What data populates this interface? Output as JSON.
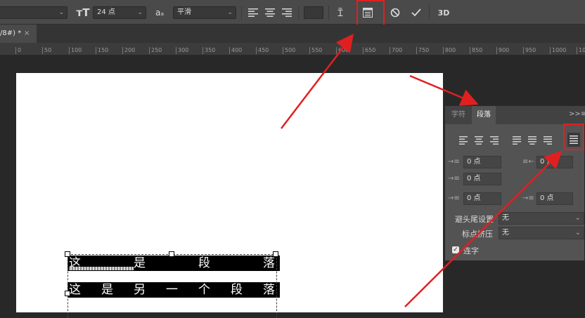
{
  "options_bar": {
    "font_size": "24 点",
    "antialias": "平滑",
    "icons": [
      "text-orientation-icon",
      "font-size-icon",
      "antialias-icon",
      "align-left-icon",
      "align-center-icon",
      "align-right-icon",
      "color-swatch",
      "warp-text-icon",
      "panel-toggle-icon",
      "cancel-icon",
      "commit-icon"
    ],
    "label_3d": "3D"
  },
  "doc_tab": {
    "title": "/8#) *",
    "close": "×"
  },
  "ruler_ticks": [
    "0",
    "50",
    "100",
    "150",
    "200",
    "250",
    "300",
    "350",
    "400",
    "450",
    "500",
    "550",
    "600",
    "650",
    "700",
    "750",
    "800",
    "850",
    "900",
    "950",
    "1000",
    "1050"
  ],
  "canvas_text": {
    "line1": [
      "这",
      "是",
      "段",
      "落"
    ],
    "line2": [
      "这",
      "是",
      "另",
      "一",
      "个",
      "段",
      "落"
    ]
  },
  "panel": {
    "tab_character": "字符",
    "tab_paragraph": "段落",
    "collapse": ">>",
    "menu": "≡",
    "indent_left": "0 点",
    "indent_right": "0 点",
    "indent_first": "0 点",
    "space_before": "0 点",
    "space_after": "0 点",
    "kinsoku_label": "避头尾设置",
    "kinsoku_value": "无",
    "mojikumi_label": "标点挤压",
    "mojikumi_value": "无",
    "hyphenate_label": "连字",
    "hyphenate_checked": true
  },
  "colors": {
    "highlight": "#e02020",
    "panel": "#535353",
    "toolbar": "#4a4a4a"
  }
}
